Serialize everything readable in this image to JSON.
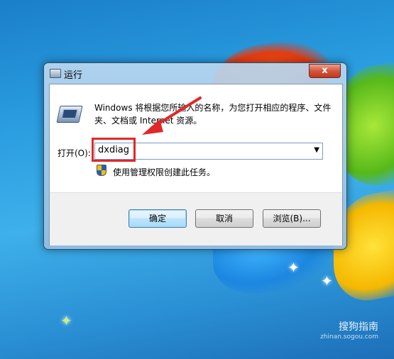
{
  "dialog": {
    "title": "运行",
    "close_symbol": "x",
    "description": "Windows 将根据您所输入的名称，为您打开相应的程序、文件夹、文档或 Internet 资源。",
    "open_label": "打开(O):",
    "command_value": "dxdiag",
    "admin_text": "使用管理权限创建此任务。",
    "buttons": {
      "ok": "确定",
      "cancel": "取消",
      "browse": "浏览(B)..."
    }
  },
  "watermark": {
    "brand": "搜狗指南",
    "url": "zhinan.sogou.com"
  },
  "icons": [
    "run-icon",
    "shield-icon",
    "chevron-down-icon",
    "close-icon",
    "run-small-icon"
  ],
  "colors": {
    "annotation": "#e02828",
    "desktop": "#2a9de0"
  }
}
